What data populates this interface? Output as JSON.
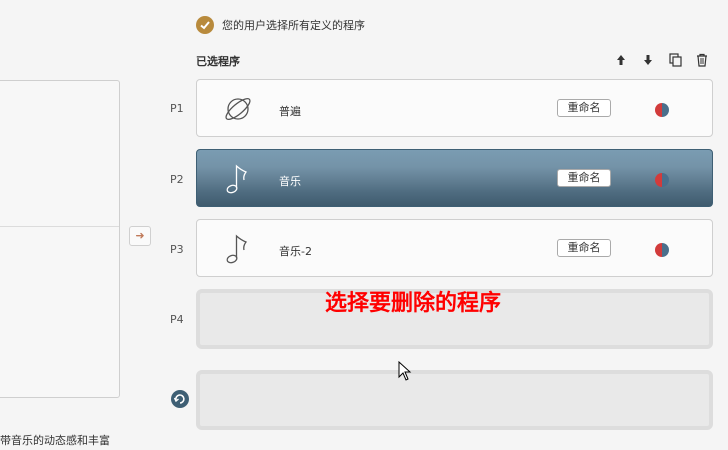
{
  "header": {
    "checkbox_label": "您的用户选择所有定义的程序",
    "selected_title": "已选程序"
  },
  "toolbar": {
    "icons": [
      "arrow-up-icon",
      "arrow-down-icon",
      "copy-icon",
      "trash-icon"
    ]
  },
  "programs": [
    {
      "slot": "P1",
      "name": "普遍",
      "icon": "planet-icon",
      "rename_label": "重命名",
      "active": false
    },
    {
      "slot": "P2",
      "name": "音乐",
      "icon": "music-note-icon",
      "rename_label": "重命名",
      "active": true
    },
    {
      "slot": "P3",
      "name": "音乐-2",
      "icon": "music-note-icon",
      "rename_label": "重命名",
      "active": false
    },
    {
      "slot": "P4",
      "name": "",
      "icon": "",
      "rename_label": "",
      "active": false
    }
  ],
  "left_panel": {
    "description": "带音乐的动态感和丰富"
  },
  "annotation": {
    "text": "选择要删除的程序"
  },
  "colors": {
    "accent_check": "#b88a3c",
    "active_card": "#5f7d92",
    "annotation": "#ff0000",
    "half_red": "#d23b3b",
    "half_blue": "#4a6f8c"
  }
}
